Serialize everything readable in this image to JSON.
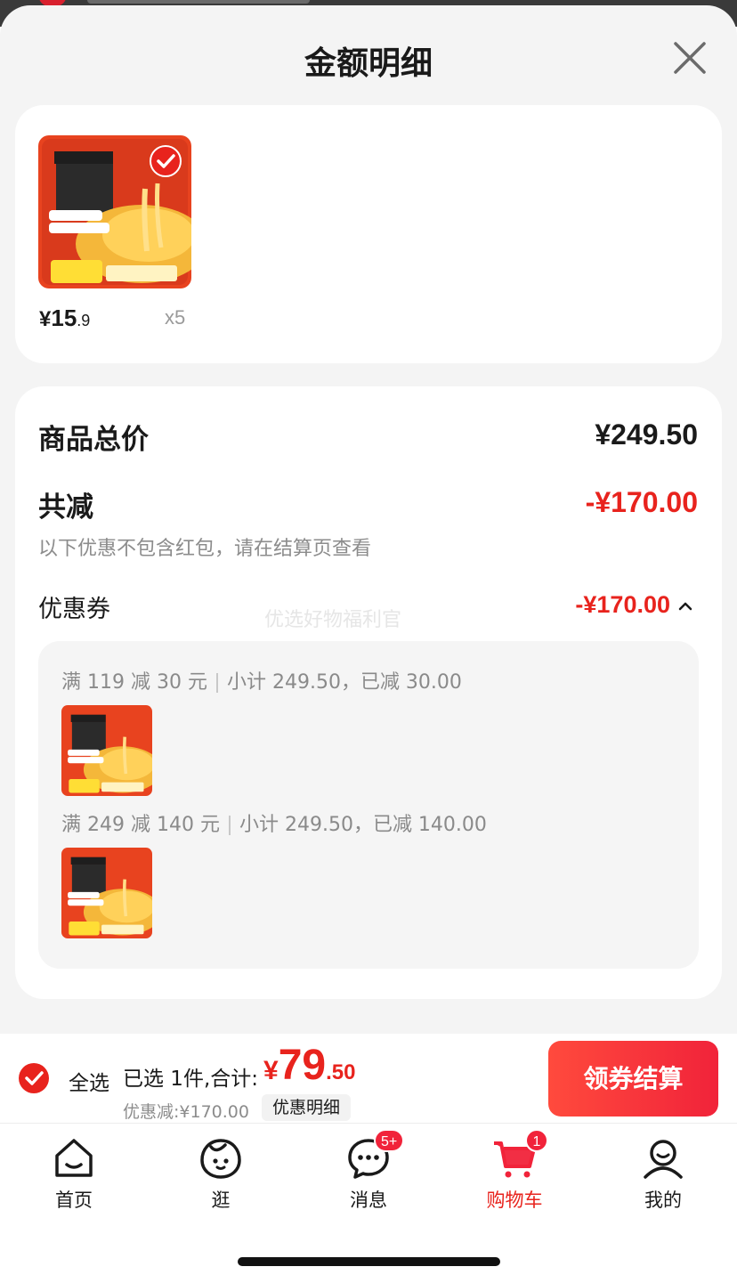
{
  "sheet": {
    "title": "金额明细"
  },
  "product": {
    "price_currency": "¥",
    "price_integer": "15",
    "price_decimal": ".9",
    "quantity": "x5"
  },
  "summary": {
    "goods_total_label": "商品总价",
    "goods_total_value": "¥249.50",
    "total_reduction_label": "共减",
    "total_reduction_value": "-¥170.00",
    "note": "以下优惠不包含红包，请在结算页查看",
    "coupon_label": "优惠券",
    "coupon_value": "-¥170.00",
    "watermark": "优选好物福利官"
  },
  "coupon_rules": [
    {
      "rule": "满 119 减 30 元",
      "detail": "小计 249.50，已减 30.00"
    },
    {
      "rule": "满 249 减 140 元",
      "detail": "小计 249.50，已减 140.00"
    }
  ],
  "checkout": {
    "select_all_label": "全选",
    "selected_text": "已选 1件,合计:",
    "total_currency": "¥",
    "total_integer": "79",
    "total_decimal": ".50",
    "discount_text": "优惠减:¥170.00",
    "detail_chip": "优惠明细",
    "button_label": "领券结算"
  },
  "tabbar": {
    "tabs": [
      {
        "label": "首页",
        "icon": "home-icon"
      },
      {
        "label": "逛",
        "icon": "face-icon"
      },
      {
        "label": "消息",
        "icon": "message-icon",
        "badge": "5+"
      },
      {
        "label": "购物车",
        "icon": "cart-icon",
        "badge": "1",
        "active": true
      },
      {
        "label": "我的",
        "icon": "profile-icon"
      }
    ]
  },
  "colors": {
    "accent_red": "#e8231d",
    "sheet_bg": "#f4f4f4",
    "card_bg": "#ffffff"
  }
}
